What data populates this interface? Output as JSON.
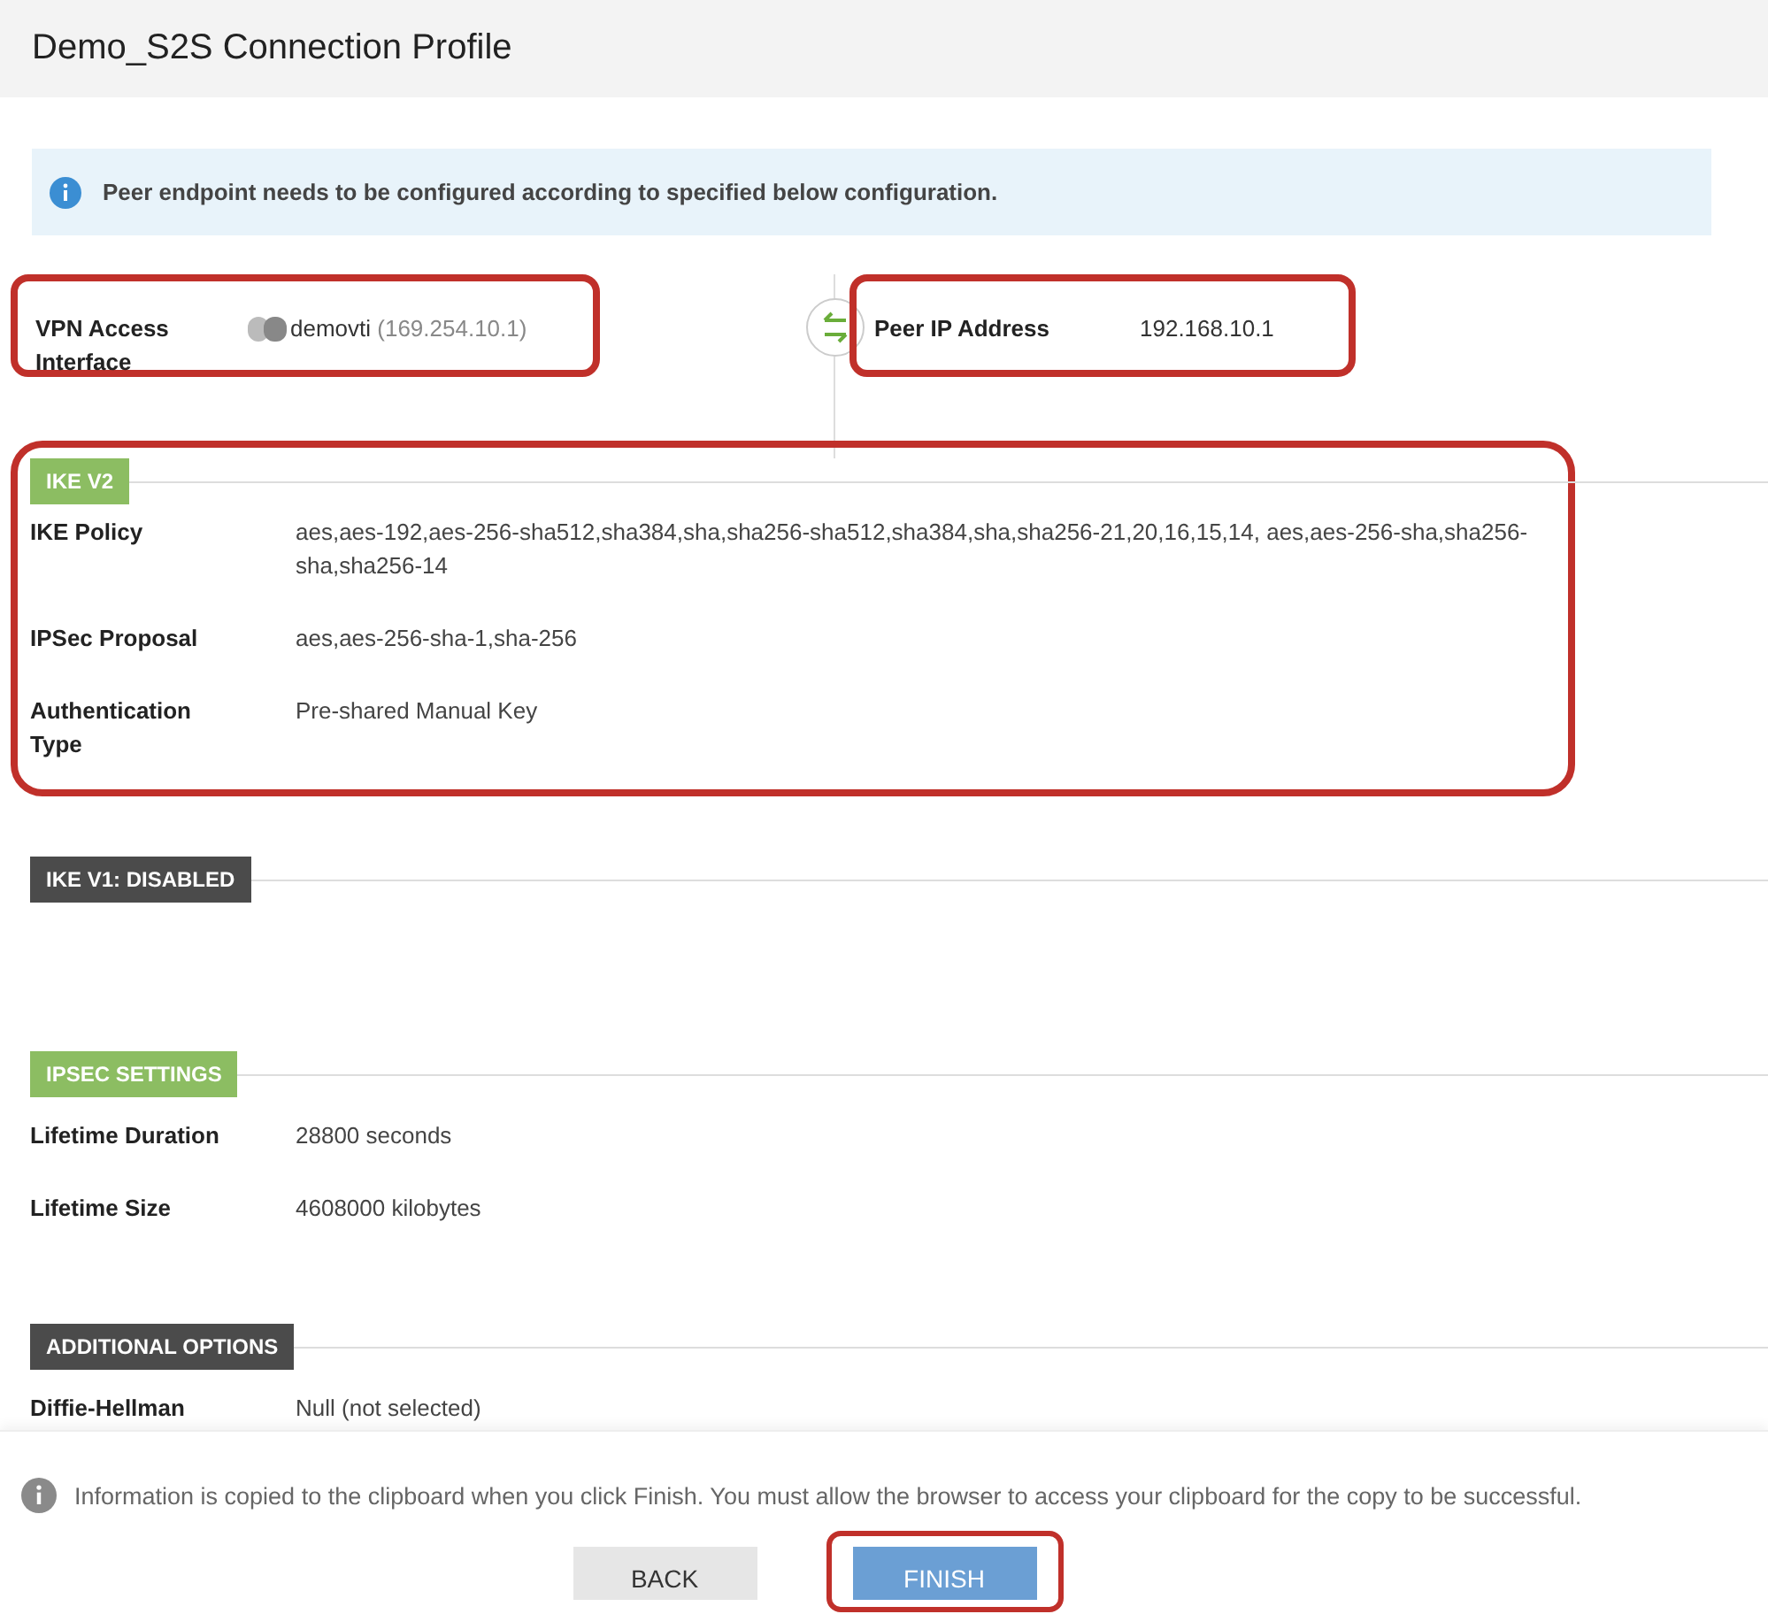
{
  "title": "Demo_S2S Connection Profile",
  "banner": {
    "text": "Peer endpoint needs to be configured according to specified below configuration."
  },
  "endpoints": {
    "local": {
      "label": "VPN Access Interface",
      "name": "demovti",
      "address": "(169.254.10.1)",
      "highlighted": true
    },
    "peer": {
      "label": "Peer IP Address",
      "value": "192.168.10.1",
      "highlighted": true
    }
  },
  "sections": [
    {
      "badge": "IKE V2",
      "color": "#8cbd62",
      "highlighted": true,
      "fields": [
        {
          "label": "IKE Policy",
          "value": "aes,aes-192,aes-256-sha512,sha384,sha,sha256-sha512,sha384,sha,sha256-21,20,16,15,14, aes,aes-256-sha,sha256-sha,sha256-14"
        },
        {
          "label": "IPSec Proposal",
          "value": "aes,aes-256-sha-1,sha-256"
        },
        {
          "label": "Authentication Type",
          "value": "Pre-shared Manual Key"
        }
      ]
    },
    {
      "badge": "IKE V1: DISABLED",
      "color": "#4b4b4b",
      "highlighted": false
    },
    {
      "badge": "IPSEC SETTINGS",
      "color": "#8cbd62",
      "highlighted": false,
      "fields": [
        {
          "label": "Lifetime Duration",
          "value": "28800 seconds"
        },
        {
          "label": "Lifetime Size",
          "value": "4608000 kilobytes"
        }
      ]
    },
    {
      "badge": "ADDITIONAL OPTIONS",
      "color": "#4b4b4b",
      "highlighted": false,
      "fields": [
        {
          "label": "Diffie-Hellman",
          "value": "Null (not selected)"
        }
      ]
    }
  ],
  "footer": {
    "note": "Information is copied to the clipboard when you click Finish. You must allow the browser to access your clipboard for the copy to be successful.",
    "buttons": [
      {
        "label": "BACK",
        "kind": "secondary",
        "highlighted": false
      },
      {
        "label": "FINISH",
        "kind": "primary",
        "highlighted": true
      }
    ]
  }
}
